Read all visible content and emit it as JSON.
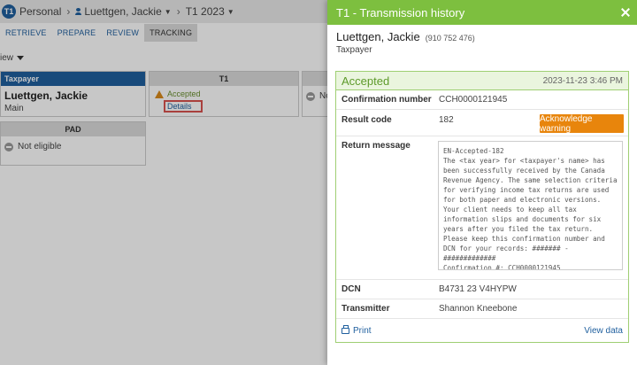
{
  "breadcrumb": {
    "badge": "T1",
    "client": "Personal",
    "taxpayer": "Luettgen, Jackie",
    "year": "T1 2023"
  },
  "tabs": [
    "RETRIEVE",
    "PREPARE",
    "REVIEW",
    "TRACKING"
  ],
  "active_tab": "TRACKING",
  "view_label": "iew",
  "cards": {
    "taxpayer": {
      "header": "Taxpayer",
      "name": "Luettgen, Jackie",
      "sub": "Main"
    },
    "t1": {
      "header": "T1",
      "status": "Accepted",
      "link": "Details"
    },
    "third": {
      "status": "No"
    },
    "pad": {
      "header": "PAD",
      "status": "Not eligible"
    }
  },
  "panel": {
    "title": "T1 - Transmission history",
    "taxpayer_name": "Luettgen, Jackie",
    "taxpayer_sin": "(910 752 476)",
    "taxpayer_role": "Taxpayer",
    "status": "Accepted",
    "date": "2023-11-23 3:46 PM",
    "confirmation_label": "Confirmation number",
    "confirmation_value": "CCH0000121945",
    "result_label": "Result code",
    "result_value": "182",
    "ack_button": "Acknowledge warning",
    "message_label": "Return message",
    "message_text": "EN-Accepted-182\nThe <tax year> for <taxpayer's name> has been successfully received by the Canada Revenue Agency. The same selection criteria for verifying income tax returns are used for both paper and electronic versions. Your client needs to keep all tax information slips and documents for six years after you filed the tax return. Please keep this confirmation number and DCN for your records:  ####### - #############\nConfirmation #: CCH0000121945",
    "dcn_label": "DCN",
    "dcn_value": "B4731 23 V4HYPW",
    "transmitter_label": "Transmitter",
    "transmitter_value": "Shannon Kneebone",
    "print_label": "Print",
    "view_data_label": "View data"
  },
  "colors": {
    "header_green": "#7dbf3f",
    "accent_blue": "#1f5f9e",
    "warning_orange": "#e8850c"
  }
}
